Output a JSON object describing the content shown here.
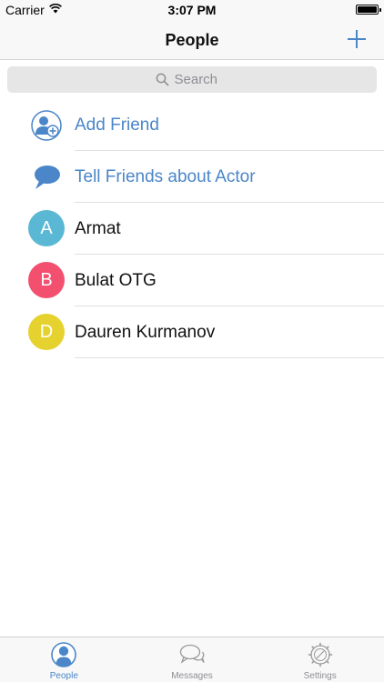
{
  "status_bar": {
    "carrier": "Carrier",
    "time": "3:07 PM"
  },
  "nav": {
    "title": "People",
    "add_icon": "plus-icon"
  },
  "search": {
    "placeholder": "Search"
  },
  "actions": [
    {
      "label": "Add Friend",
      "icon": "add-friend-icon"
    },
    {
      "label": "Tell Friends about Actor",
      "icon": "speech-bubble-icon"
    }
  ],
  "contacts": [
    {
      "initial": "A",
      "name": "Armat",
      "color": "#5bb8d4"
    },
    {
      "initial": "B",
      "name": "Bulat OTG",
      "color": "#f2506e"
    },
    {
      "initial": "D",
      "name": "Dauren Kurmanov",
      "color": "#e6d22e"
    }
  ],
  "tabs": [
    {
      "label": "People",
      "icon": "people-icon",
      "active": true
    },
    {
      "label": "Messages",
      "icon": "messages-icon",
      "active": false
    },
    {
      "label": "Settings",
      "icon": "settings-icon",
      "active": false
    }
  ],
  "colors": {
    "accent": "#4a86c8",
    "inactive": "#8e8e93",
    "bar_background": "#f8f8f8"
  }
}
